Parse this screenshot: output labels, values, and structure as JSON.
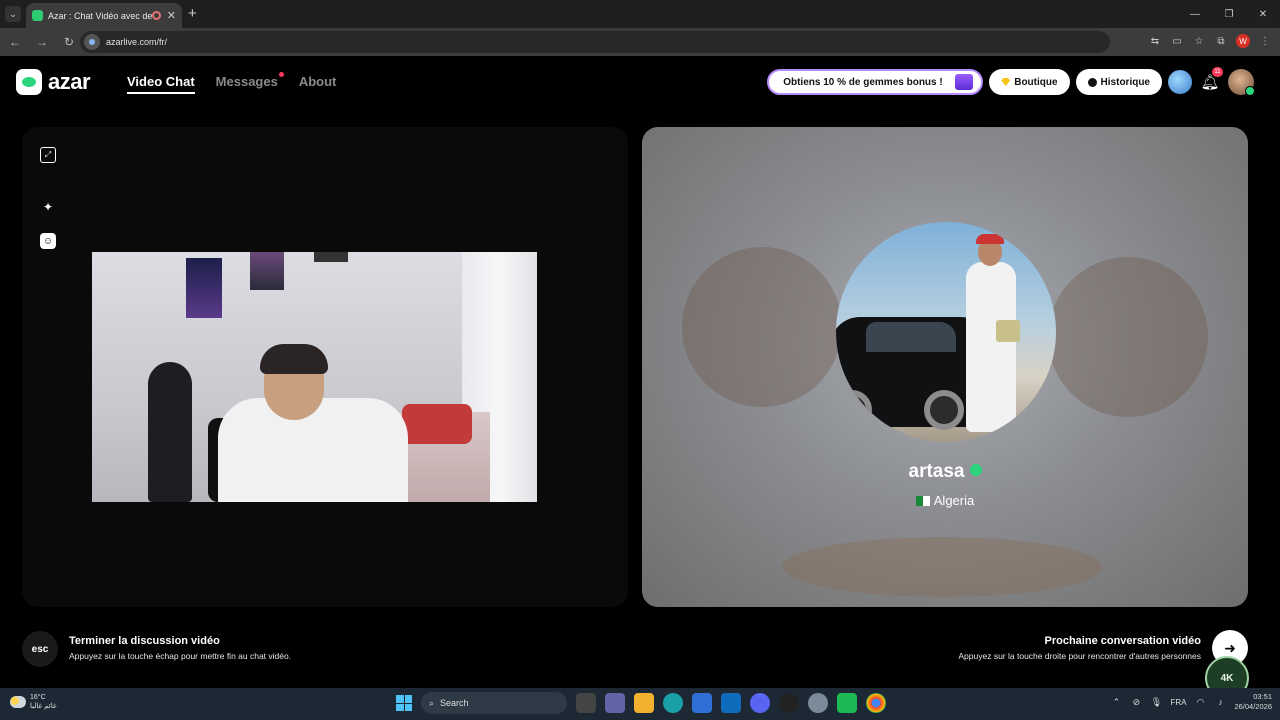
{
  "browser": {
    "tab_title": "Azar : Chat Vidéo avec de n",
    "url": "azarlive.com/fr/",
    "profile_initial": "W"
  },
  "app": {
    "logo_text": "azar",
    "nav": [
      {
        "label": "Video Chat",
        "active": true
      },
      {
        "label": "Messages",
        "has_dot": true
      },
      {
        "label": "About"
      }
    ],
    "promo_label": "Obtiens 10 % de gemmes bonus !",
    "shop_label": "Boutique",
    "history_label": "Historique",
    "notification_count": "11",
    "accent_color": "#2bd47d"
  },
  "partner": {
    "name": "artasa",
    "country": "Algeria"
  },
  "hints": {
    "end_key": "esc",
    "end_title": "Terminer la discussion vidéo",
    "end_sub": "Appuyez sur la touche échap pour mettre fin au chat vidéo.",
    "next_title": "Prochaine conversation vidéo",
    "next_sub": "Appuyez sur la touche droite pour rencontrer d'autres personnes"
  },
  "taskbar": {
    "weather_temp": "16°C",
    "weather_desc": "غائم غالبا",
    "search_placeholder": "Search",
    "lang": "FRA",
    "time": "03:51",
    "date": "26/04/2026"
  },
  "watermark_text": "4K"
}
